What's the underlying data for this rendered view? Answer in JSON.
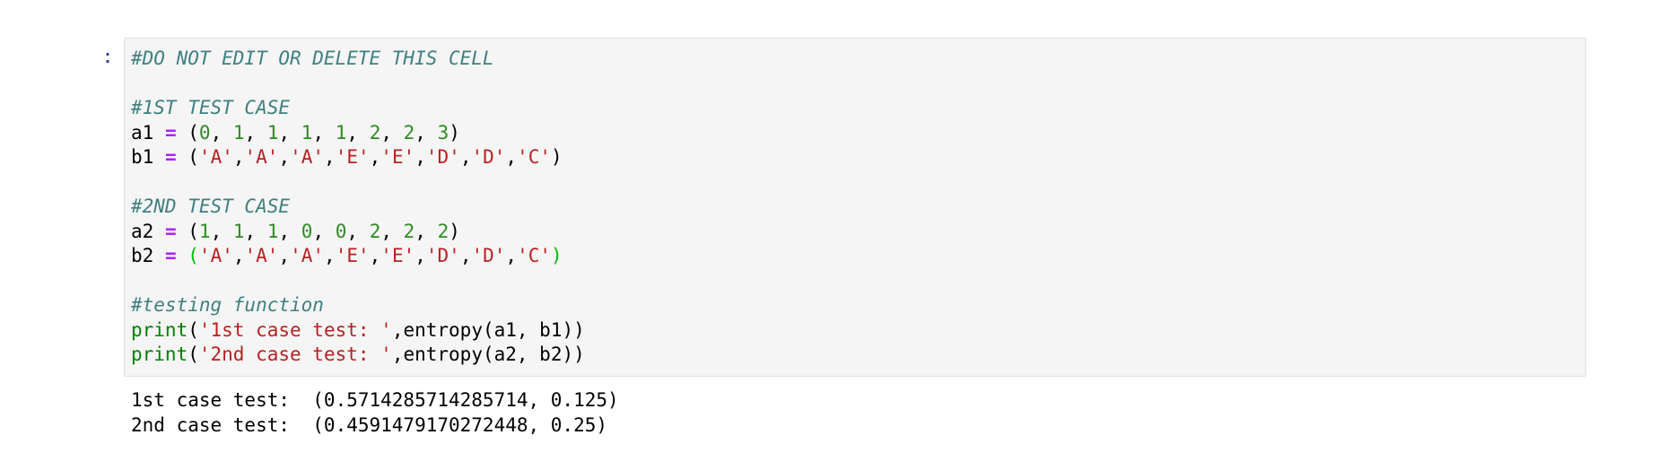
{
  "cell": {
    "prompt": ":",
    "lines": [
      {
        "comment": "#DO NOT EDIT OR DELETE THIS CELL"
      },
      {},
      {
        "comment": "#1ST TEST CASE"
      },
      {
        "name": "a1",
        "op": "=",
        "open": "(",
        "items": [
          "0",
          "1",
          "1",
          "1",
          "1",
          "2",
          "2",
          "3"
        ],
        "close": ")",
        "kind": "num"
      },
      {
        "name": "b1",
        "op": "=",
        "open": "(",
        "items": [
          "'A'",
          "'A'",
          "'A'",
          "'E'",
          "'E'",
          "'D'",
          "'D'",
          "'C'"
        ],
        "close": ")",
        "kind": "str"
      },
      {},
      {
        "comment": "#2ND TEST CASE"
      },
      {
        "name": "a2",
        "op": "=",
        "open": "(",
        "items": [
          "1",
          "1",
          "1",
          "0",
          "0",
          "2",
          "2",
          "2"
        ],
        "close": ")",
        "kind": "num"
      },
      {
        "name": "b2",
        "op": "=",
        "open": "(",
        "items": [
          "'A'",
          "'A'",
          "'A'",
          "'E'",
          "'E'",
          "'D'",
          "'D'",
          "'C'"
        ],
        "close": ")",
        "kind": "str",
        "matched_brackets": true
      },
      {},
      {
        "comment": "#testing function"
      },
      {
        "print": "print",
        "string": "'1st case test: '",
        "rest": ",entropy(a1, b1))"
      },
      {
        "print": "print",
        "string": "'2nd case test: '",
        "rest": ",entropy(a2, b2))"
      }
    ]
  },
  "output": {
    "lines": [
      "1st case test:  (0.5714285714285714, 0.125)",
      "2nd case test:  (0.4591479170272448, 0.25)"
    ]
  }
}
